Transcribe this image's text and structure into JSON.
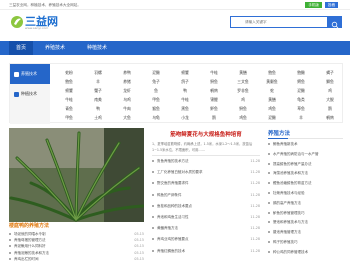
{
  "topbar": {
    "welcome": "三益农业网，种植技术、养殖技术大全网站。",
    "login": "手机版",
    "register": "投稿"
  },
  "header": {
    "logo_text": "三益网",
    "logo_url": "www.sanyi.com",
    "search_placeholder": "请输入关键字"
  },
  "nav": {
    "items": [
      "首页",
      "养殖技术",
      "种植技术"
    ]
  },
  "categories": {
    "tabs": [
      "养殖技术",
      "种植技术"
    ],
    "grid": [
      [
        "蛇粉",
        "羽螺",
        "养鸭",
        "泥鳅",
        "螃蟹",
        "牛蛙",
        "黄鳝",
        "鲍鱼",
        "鲍鳅",
        "蝎子"
      ],
      [
        "鲍鱼",
        "羊",
        "养猪",
        "兔子",
        "鸽子",
        "鲟鱼",
        "三文鱼",
        "黄颡鱼",
        "鳄鱼",
        "鲫鱼"
      ],
      [
        "螃蟹",
        "蟹子",
        "龙虾",
        "鱼",
        "鸭",
        "鹌鹑",
        "罗非鱼",
        "蛇",
        "泥鳅",
        "鸡"
      ],
      [
        "牛蛙",
        "南美",
        "乌鸡",
        "甲鱼",
        "牛蛙",
        "锦鲤",
        "鸡",
        "黄鳝",
        "龟类",
        "大鲵"
      ],
      [
        "青鱼",
        "鸭",
        "牛肉",
        "猴鱼",
        "黑鱼",
        "鲈鱼",
        "鲟鱼",
        "鸡鱼",
        "草鱼",
        "鹅"
      ],
      [
        "甲鱼",
        "土鸡",
        "大鱼",
        "乌龟",
        "小龙",
        "鹅",
        "鸡鱼",
        "泥鳅",
        "羊",
        "鹌鹑"
      ]
    ]
  },
  "featured": {
    "caption": "楼庭鸭的养殖方法",
    "list": [
      {
        "text": "场泥就的饲喂水令制",
        "date": "05-15"
      },
      {
        "text": "养殖母猪的管理方法",
        "date": "05-15"
      },
      {
        "text": "养泥鳅用什么饲料好",
        "date": "05-15"
      },
      {
        "text": "养殖泥鳅的技术和方法",
        "date": "05-15"
      },
      {
        "text": "养鸡出栏的时间",
        "date": "05-15"
      }
    ]
  },
  "headline": {
    "title": "筋吻鲟夏花与大规格鱼种培育",
    "desc": "1、夏季培苗筋吻鲟，约翰承上述，1.5米，水深1.2～1.5米，放苗后1~1.5米水位，不限面积，可用……"
  },
  "middle_list": [
    {
      "text": "鲁鱼养殖的技术方法",
      "date": "11-28"
    },
    {
      "text": "工厂化养殖白鲢对水质的要求",
      "date": "11-28"
    },
    {
      "text": "野交鱼的养殖要求件",
      "date": "11-28"
    },
    {
      "text": "鸭鱼的产卵条件",
      "date": "11-28"
    },
    {
      "text": "鱼茬和品种的技术要点",
      "date": "11-28"
    },
    {
      "text": "养池和鸡鱼生活习性",
      "date": "11-28"
    },
    {
      "text": "黄鳝养殖方法",
      "date": "11-28"
    },
    {
      "text": "养鸡业鸡的养殖要点",
      "date": "11-28"
    },
    {
      "text": "养殖红鲷鱼的技术",
      "date": "11-28"
    }
  ],
  "right_section": {
    "title": "养殖方法",
    "list": [
      "鲫鱼养殖新技术",
      "水产养殖的病防治与一水产管",
      "提高鲟鱼的养殖产量办法",
      "海藻池养殖技术和方法",
      "鲤鱼池塘鲟鱼的育苗方法",
      "牡蛎养殖技术与经验",
      "鹅的高产养殖方法",
      "鲈鱼的养殖管理技巧",
      "蟹池和养殖技术与方法",
      "鳖池养殖管理方法",
      "鸭子的养殖技巧",
      "种公鸡的饲养管理技术"
    ]
  },
  "colors": {
    "brand": "#2566c9",
    "nav_active": "#1550ab",
    "accent_red": "#c8201a",
    "accent_orange": "#e07a10",
    "green_button": "#3eb035"
  }
}
